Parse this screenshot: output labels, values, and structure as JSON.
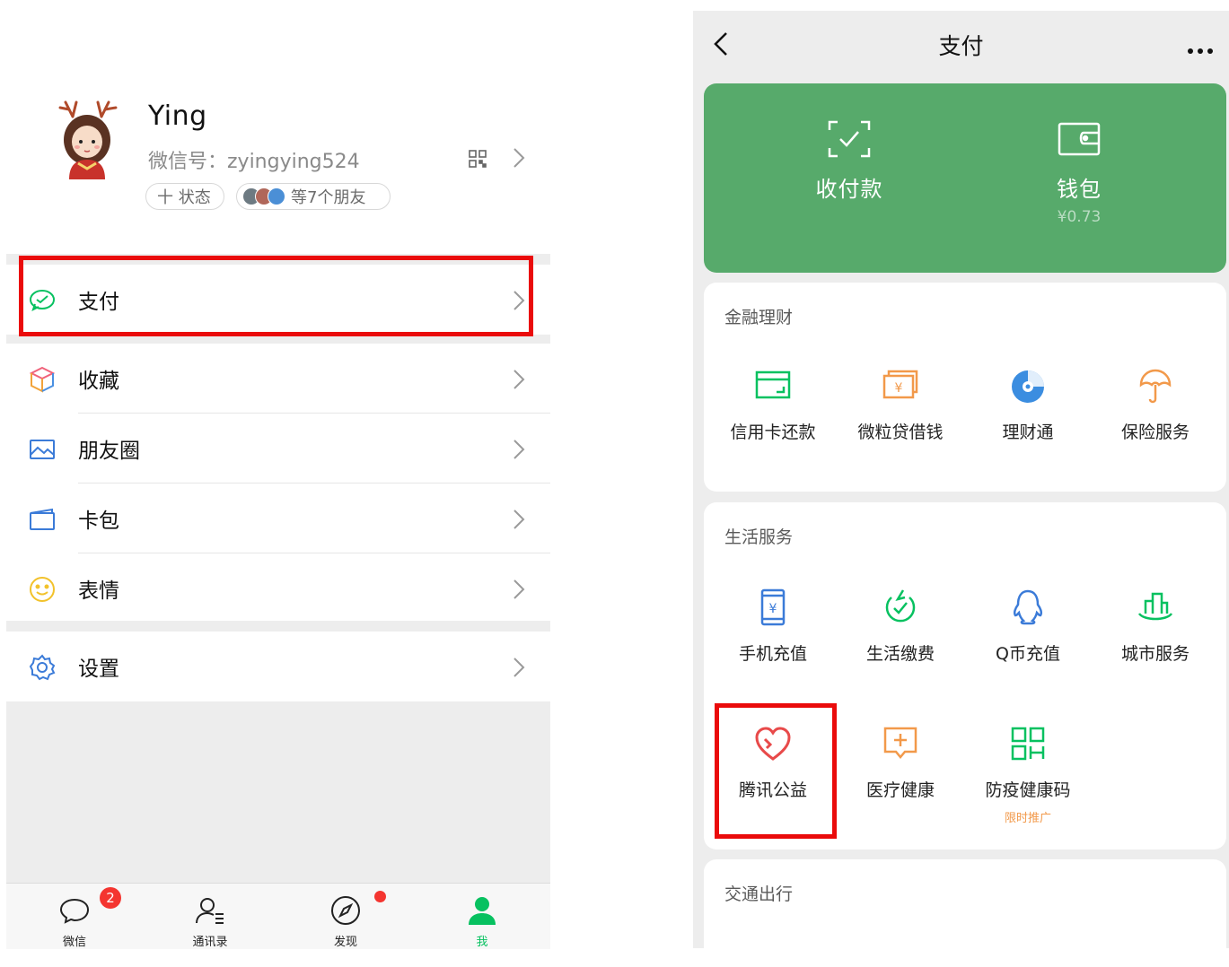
{
  "profile": {
    "name": "Ying",
    "wechat_id": "微信号：zyingying524",
    "status_label": "十 状态",
    "friends_label": "等7个朋友"
  },
  "menu": [
    {
      "label": "支付",
      "icon": "wechat-pay-icon"
    },
    {
      "label": "收藏",
      "icon": "cube-icon"
    },
    {
      "label": "朋友圈",
      "icon": "image-icon"
    },
    {
      "label": "卡包",
      "icon": "card-wallet-icon"
    },
    {
      "label": "表情",
      "icon": "smile-icon"
    },
    {
      "label": "设置",
      "icon": "gear-icon"
    }
  ],
  "tabbar": [
    {
      "label": "微信",
      "badge": "2",
      "icon": "chat-bubble-icon"
    },
    {
      "label": "通讯录",
      "icon": "contacts-icon"
    },
    {
      "label": "发现",
      "icon": "compass-icon"
    },
    {
      "label": "我",
      "icon": "person-icon",
      "active": true
    }
  ],
  "pay": {
    "title": "支付",
    "receive_label": "收付款",
    "wallet_label": "钱包",
    "wallet_balance": "¥0.73",
    "finance": {
      "title": "金融理财",
      "items": [
        {
          "label": "信用卡还款",
          "icon": "credit-card-icon"
        },
        {
          "label": "微粒贷借钱",
          "icon": "loan-icon"
        },
        {
          "label": "理财通",
          "icon": "wealth-icon"
        },
        {
          "label": "保险服务",
          "icon": "umbrella-icon"
        }
      ]
    },
    "life": {
      "title": "生活服务",
      "items": [
        {
          "label": "手机充值",
          "icon": "phone-topup-icon"
        },
        {
          "label": "生活缴费",
          "icon": "utility-icon"
        },
        {
          "label": "Q币充值",
          "icon": "qq-penguin-icon"
        },
        {
          "label": "城市服务",
          "icon": "city-icon"
        },
        {
          "label": "腾讯公益",
          "icon": "charity-heart-icon"
        },
        {
          "label": "医疗健康",
          "icon": "medical-icon"
        },
        {
          "label": "防疫健康码",
          "icon": "qr-code-icon",
          "sub": "限时推广"
        }
      ]
    },
    "transport": {
      "title": "交通出行"
    }
  },
  "colors": {
    "accent_green": "#07c160",
    "pay_green": "#57aa6b",
    "highlight_red": "#ea0b0b",
    "badge_red": "#f43530"
  }
}
